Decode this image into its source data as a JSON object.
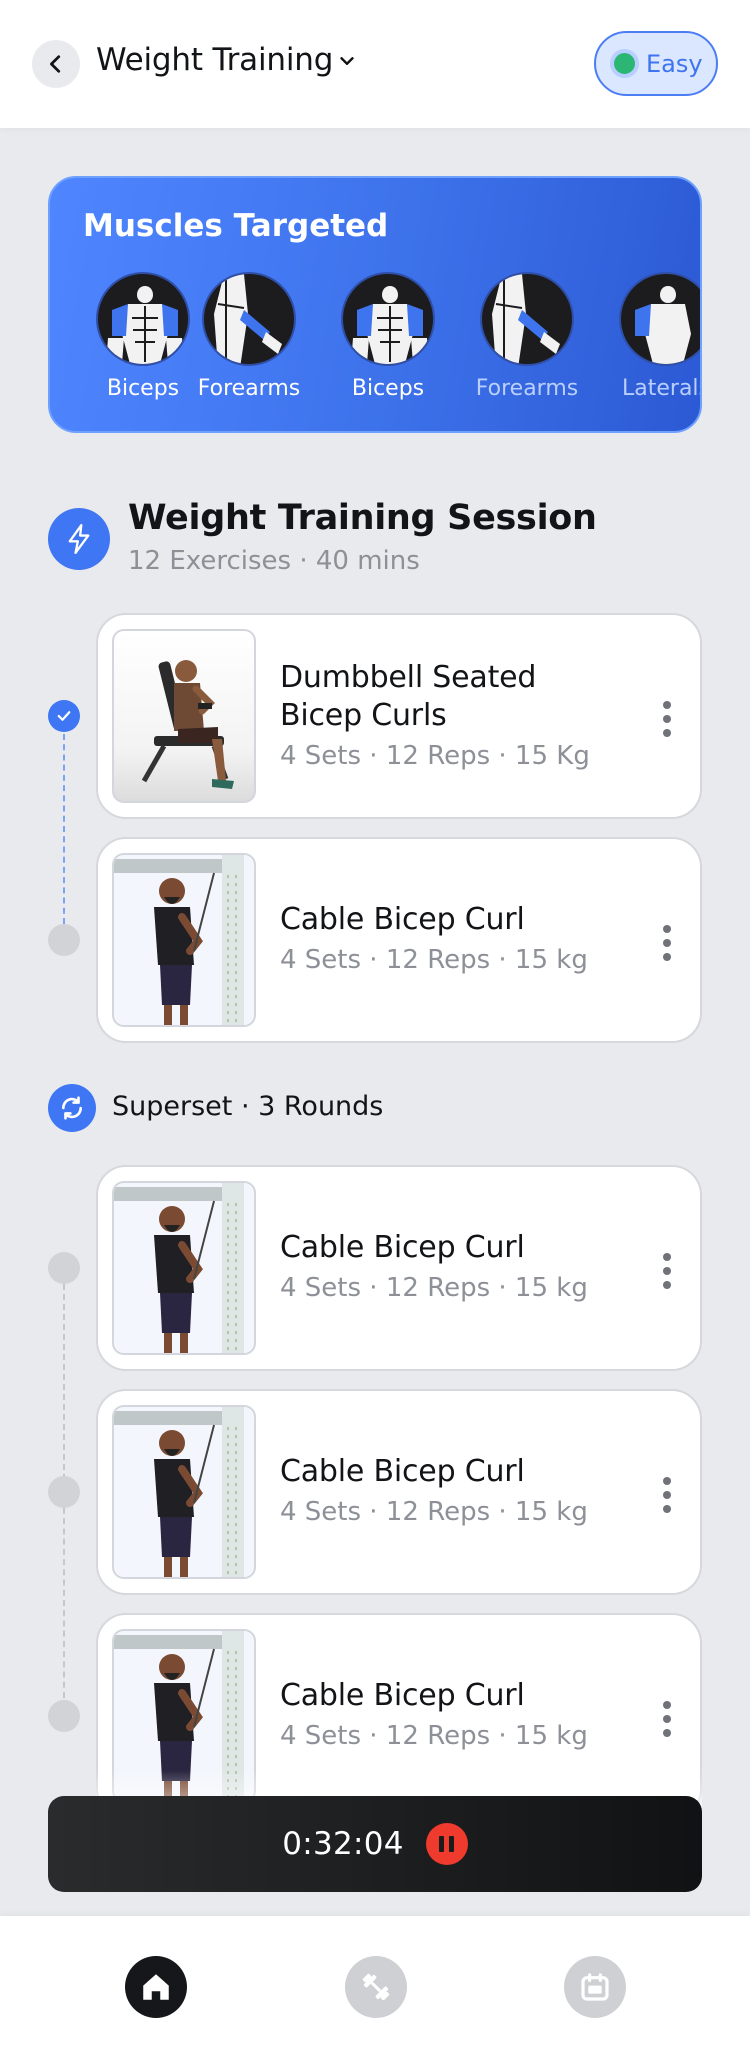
{
  "header": {
    "title": "Weight Training",
    "difficulty": "Easy"
  },
  "muscles": {
    "title": "Muscles Targeted",
    "items": [
      {
        "label": "Biceps",
        "icon": "front-body-biceps-icon"
      },
      {
        "label": "Forearms",
        "icon": "side-arm-forearm-icon"
      },
      {
        "label": "Biceps",
        "icon": "front-body-biceps-icon"
      },
      {
        "label": "Forearms",
        "icon": "side-arm-forearm-icon"
      },
      {
        "label": "Laterals",
        "icon": "front-body-laterals-icon"
      }
    ]
  },
  "session": {
    "title": "Weight Training Session",
    "meta": "12 Exercises · 40 mins"
  },
  "exercises": [
    {
      "name_line1": "Dumbbell Seated",
      "name_line2": "Bicep Curls",
      "meta": "4 Sets · 12 Reps · 15 Kg",
      "done": true
    },
    {
      "name": "Cable Bicep Curl",
      "meta": "4 Sets · 12 Reps · 15 kg",
      "done": false
    }
  ],
  "superset": {
    "label": "Superset · 3 Rounds",
    "exercises": [
      {
        "name": "Cable Bicep Curl",
        "meta": "4 Sets · 12 Reps · 15 kg"
      },
      {
        "name": "Cable Bicep Curl",
        "meta": "4 Sets · 12 Reps · 15 kg"
      },
      {
        "name": "Cable Bicep Curl",
        "meta": "4 Sets · 12 Reps · 15 kg"
      }
    ]
  },
  "timer": {
    "value": "0:32:04"
  },
  "nav": {
    "items": [
      "home-icon",
      "dumbbell-icon",
      "calendar-icon"
    ],
    "active": "home-icon"
  },
  "colors": {
    "accent": "#3e76f3",
    "pause": "#ee3b2e",
    "easy": "#2bb673"
  }
}
